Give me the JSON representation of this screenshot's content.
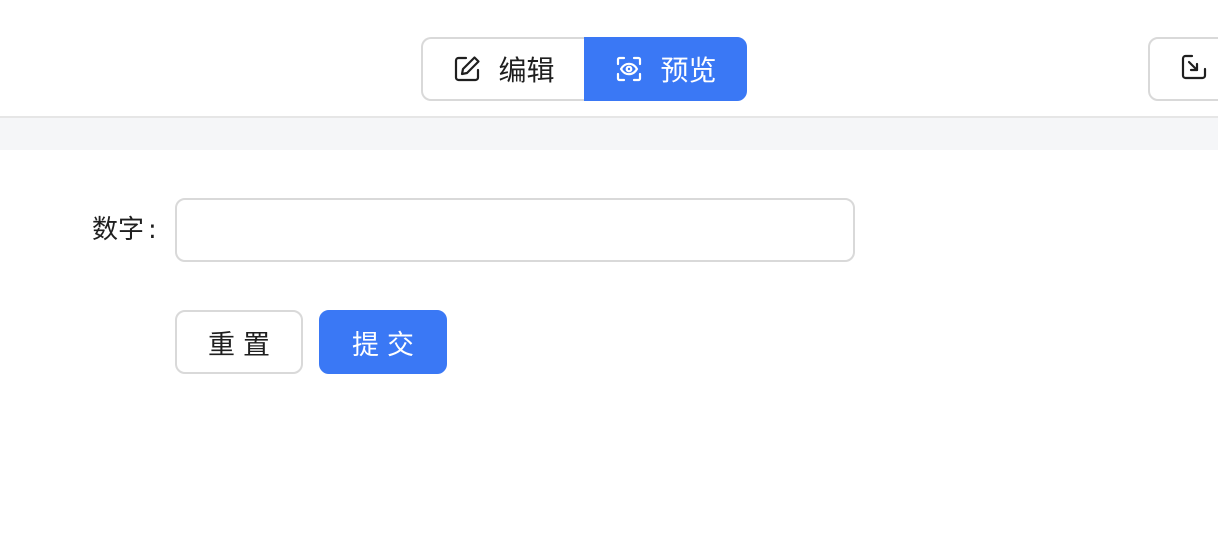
{
  "header": {
    "mode_toggle": {
      "edit_label": "编辑",
      "edit_icon": "edit-icon",
      "preview_label": "预览",
      "preview_icon": "eye-scan-icon",
      "active": "preview"
    },
    "export_icon": "export-icon"
  },
  "form": {
    "field_label": "数字",
    "field_colon": ":",
    "field_value": "",
    "field_placeholder": "",
    "reset_label": "重置",
    "submit_label": "提交"
  },
  "colors": {
    "primary": "#3a78f5",
    "border": "#d9d9d9",
    "band": "#f5f6f8"
  }
}
